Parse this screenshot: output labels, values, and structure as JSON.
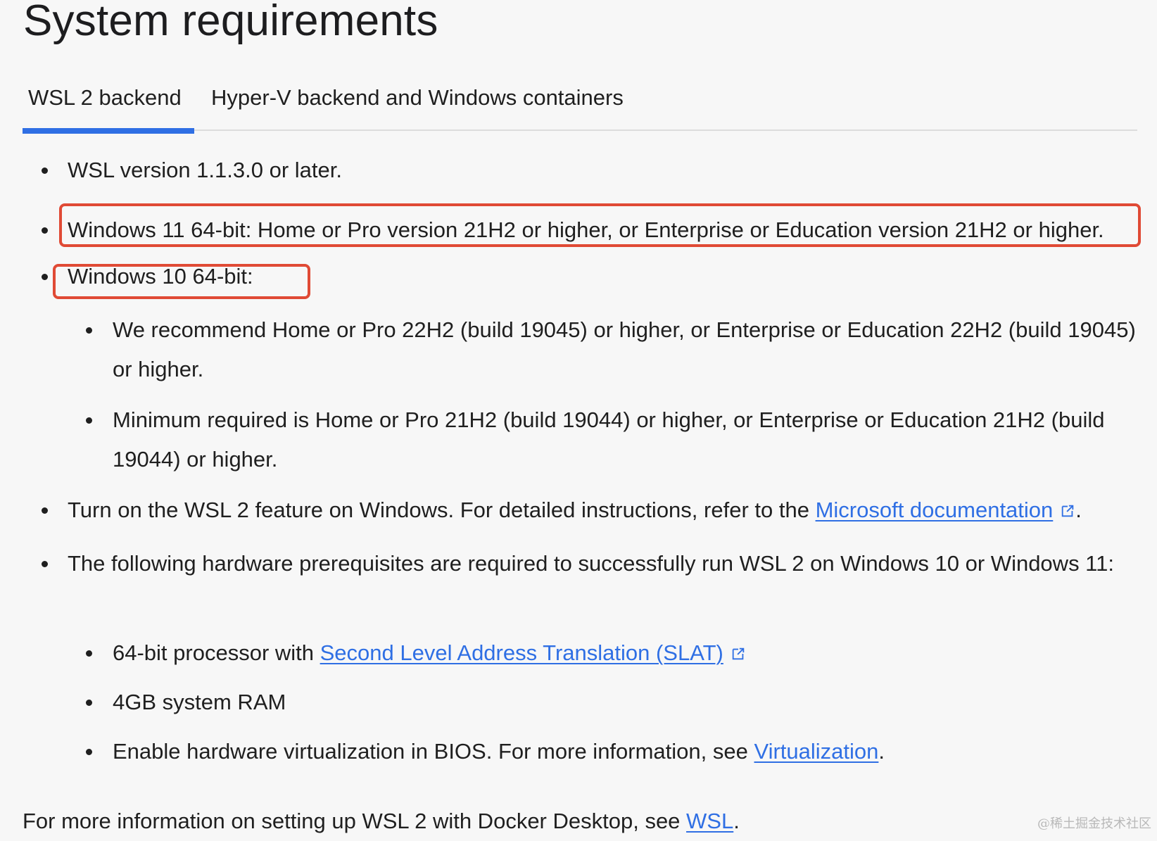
{
  "page": {
    "title": "System requirements"
  },
  "tabs": [
    {
      "label": "WSL 2 backend",
      "selected": true
    },
    {
      "label": "Hyper-V backend and Windows containers",
      "selected": false
    }
  ],
  "requirements": {
    "wsl_version": "WSL version 1.1.3.0 or later.",
    "windows11": "Windows 11 64-bit: Home or Pro version 21H2 or higher, or Enterprise or Education version 21H2 or higher.",
    "windows10": "Windows 10 64-bit:",
    "windows10_recommend": "We recommend Home or Pro 22H2 (build 19045) or higher, or Enterprise or Education 22H2 (build 19045) or higher.",
    "windows10_minimum": "Minimum required is Home or Pro 21H2 (build 19044) or higher, or Enterprise or Education 21H2 (build 19044) or higher.",
    "turn_on_prefix": "Turn on the WSL 2 feature on Windows. For detailed instructions, refer to the ",
    "microsoft_docs_link": "Microsoft documentation",
    "turn_on_suffix": ".",
    "hardware_intro": "The following hardware prerequisites are required to successfully run WSL 2 on Windows 10 or Windows 11:",
    "hardware": {
      "processor_prefix": "64-bit processor with ",
      "slat_link": "Second Level Address Translation (SLAT)",
      "ram": "4GB system RAM",
      "bios_prefix": "Enable hardware virtualization in BIOS. For more information, see ",
      "virtualization_link": "Virtualization",
      "bios_suffix": "."
    }
  },
  "footer": {
    "prefix": "For more information on setting up WSL 2 with Docker Desktop, see ",
    "wsl_link": "WSL",
    "suffix": "."
  },
  "watermark": "@稀土掘金技术社区",
  "colors": {
    "accent": "#2f6fe4",
    "highlight": "#e04a35",
    "text": "#1f1f1f",
    "background": "#f7f7f7"
  },
  "icons": {
    "external_link": "external-link-icon"
  }
}
